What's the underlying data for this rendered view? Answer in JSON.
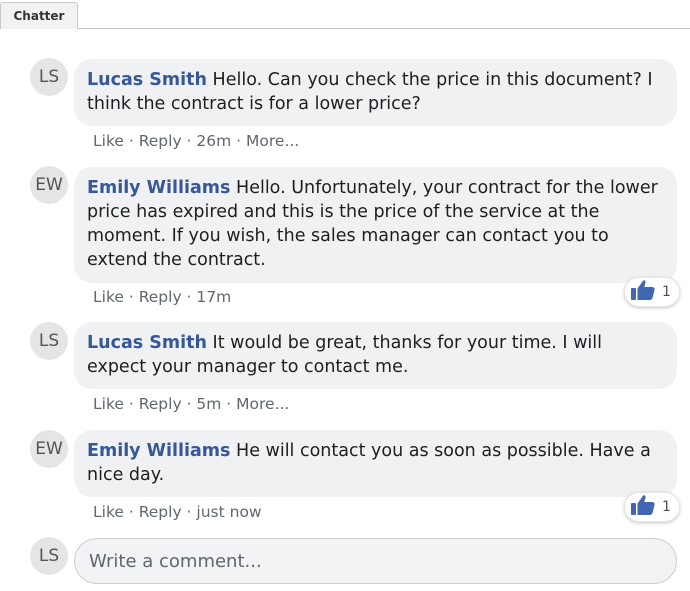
{
  "tab": {
    "label": "Chatter"
  },
  "comments": [
    {
      "initials": "LS",
      "author": "Lucas Smith",
      "text": "Hello. Can you check the price in this document? I think the contract is for a lower price?",
      "like": "Like",
      "reply": "Reply",
      "time": "26m",
      "more": "More..."
    },
    {
      "initials": "EW",
      "author": "Emily Williams",
      "text": "Hello. Unfortunately, your contract for the lower price has expired and this is the price of the service at the moment. If you wish, the sales manager can contact you to extend the contract.",
      "like": "Like",
      "reply": "Reply",
      "time": "17m",
      "reactions": "1"
    },
    {
      "initials": "LS",
      "author": "Lucas Smith",
      "text": "It would be great, thanks for your time. I will expect your manager to contact me.",
      "like": "Like",
      "reply": "Reply",
      "time": "5m",
      "more": "More..."
    },
    {
      "initials": "EW",
      "author": "Emily Williams",
      "text": "He will contact you as soon as possible. Have a nice day.",
      "like": "Like",
      "reply": "Reply",
      "time": "just now",
      "reactions": "1"
    }
  ],
  "composer": {
    "initials": "LS",
    "placeholder": "Write a comment..."
  },
  "colors": {
    "author": "#365899",
    "bubble": "#f0f1f3",
    "like_blue": "#4267b2"
  },
  "icons": {
    "reaction": "thumbs-up-icon"
  }
}
